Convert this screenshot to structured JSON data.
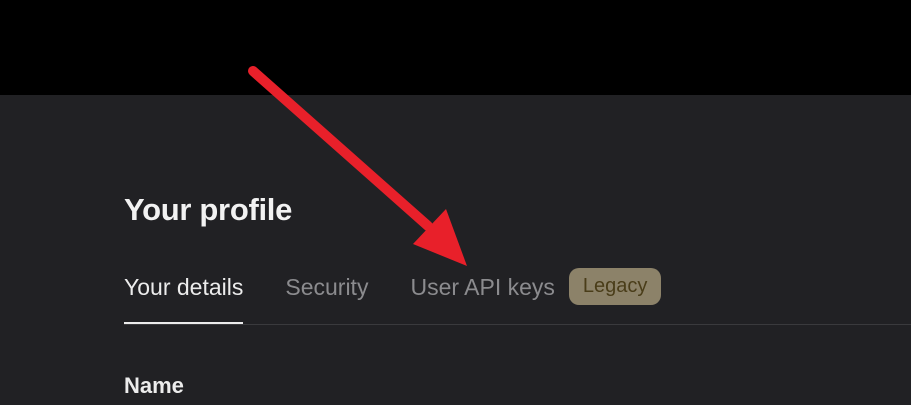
{
  "page": {
    "title": "Your profile"
  },
  "tabs": [
    {
      "label": "Your details",
      "active": true
    },
    {
      "label": "Security",
      "active": false
    },
    {
      "label": "User API keys",
      "active": false,
      "badge": "Legacy"
    }
  ],
  "form": {
    "name_label": "Name"
  },
  "colors": {
    "top_bar": "#000000",
    "background": "#212124",
    "text_primary": "#ececec",
    "text_muted": "#8b8b8e",
    "badge_bg": "#8c8269",
    "badge_text": "#4a3d19",
    "annotation_arrow": "#e8202a"
  },
  "annotation": {
    "icon": "red-arrow-icon"
  }
}
